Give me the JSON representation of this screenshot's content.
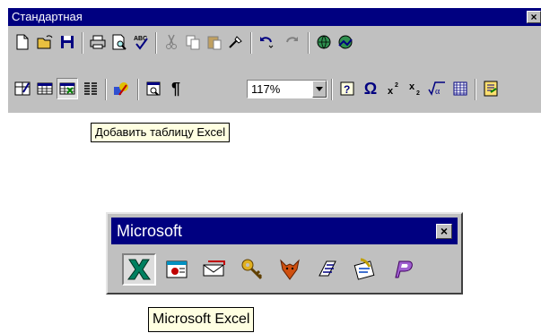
{
  "standard_toolbar": {
    "title": "Стандартная",
    "close_glyph": "×",
    "row1": [
      "new-document-icon",
      "open-folder-icon",
      "save-icon",
      "print-icon",
      "print-preview-icon",
      "spelling-icon",
      "cut-icon",
      "copy-icon",
      "paste-icon",
      "format-painter-icon",
      "undo-icon",
      "redo-icon",
      "web-toolbar-icon",
      "hyperlink-icon"
    ],
    "row2": [
      "tables-borders-icon",
      "insert-table-icon",
      "insert-excel-table-icon",
      "columns-icon",
      "drawing-icon",
      "document-map-icon",
      "show-paragraph-icon",
      "help-icon",
      "symbol-icon",
      "superscript-icon",
      "subscript-icon",
      "equation-icon",
      "grid-icon",
      "office-assistant-icon"
    ],
    "zoom_value": "117%",
    "paragraph_glyph": "¶",
    "omega_glyph": "Ω",
    "tooltip": "Добавить таблицу Excel"
  },
  "microsoft_toolbar": {
    "title": "Microsoft",
    "close_glyph": "×",
    "buttons": [
      "excel-icon",
      "powerpoint-icon",
      "mail-icon",
      "access-key-icon",
      "foxpro-icon",
      "project-icon",
      "schedule-icon",
      "publisher-icon"
    ],
    "tooltip": "Microsoft Excel"
  }
}
